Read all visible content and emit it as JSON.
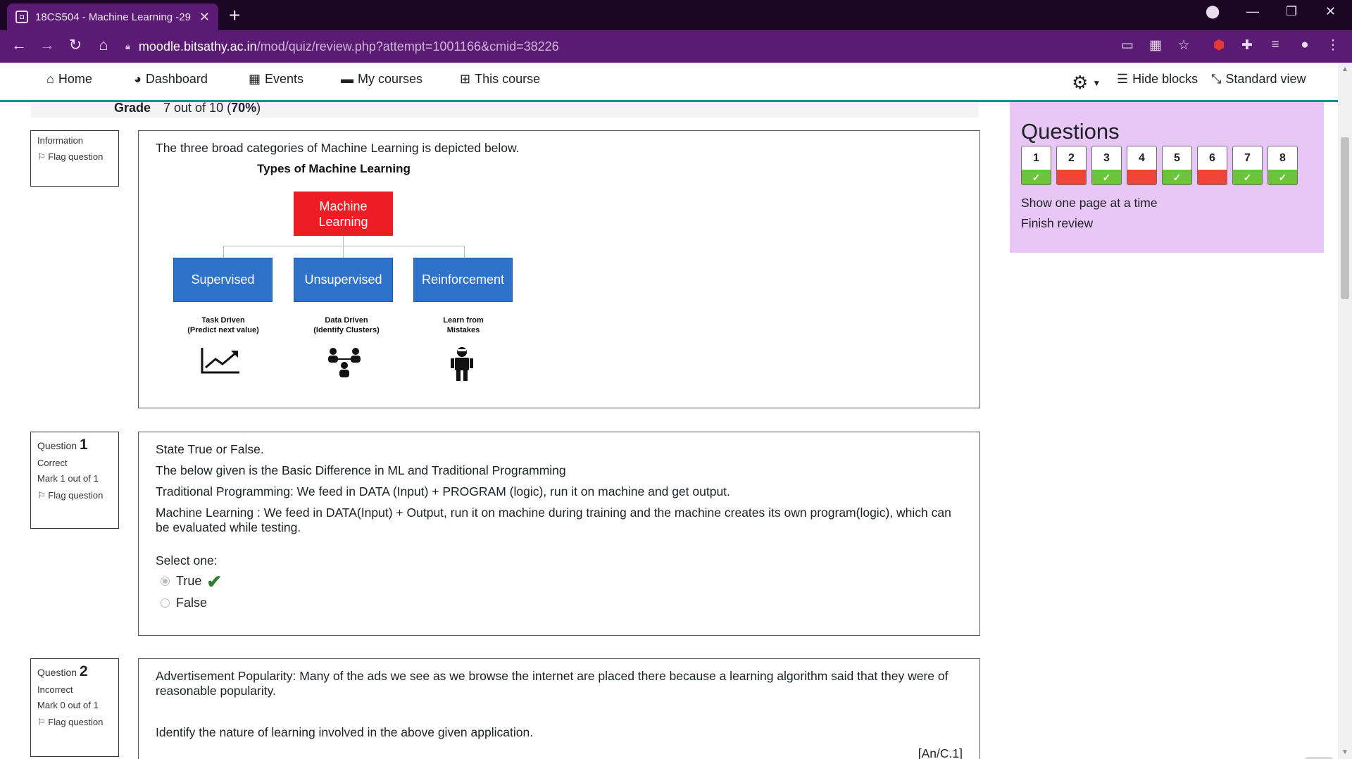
{
  "browser": {
    "tab_title": "18CS504 - Machine Learning -29",
    "tab_close": "✕",
    "new_tab": "+",
    "url_domain": "moodle.bitsathy.ac.in",
    "url_path": "/mod/quiz/review.php?attempt=1001166&cmid=38226"
  },
  "navbar": {
    "home": "Home",
    "dashboard": "Dashboard",
    "events": "Events",
    "my_courses": "My courses",
    "this_course": "This course",
    "hide_blocks": "Hide blocks",
    "standard_view": "Standard view"
  },
  "grade": {
    "label": "Grade",
    "value": "7",
    "suffix": " out of 10 (",
    "percent": "70%",
    "close": ")"
  },
  "information": {
    "label": "Information",
    "flag": "Flag question",
    "text": "The three broad categories of Machine Learning is depicted below.",
    "diagram": {
      "title": "Types of Machine Learning",
      "root": "Machine Learning",
      "children": [
        {
          "label": "Supervised",
          "caption_1": "Task Driven",
          "caption_2": "(Predict next value)",
          "icon": "trend-chart-icon"
        },
        {
          "label": "Unsupervised",
          "caption_1": "Data Driven",
          "caption_2": "(Identify Clusters)",
          "icon": "cluster-people-icon"
        },
        {
          "label": "Reinforcement",
          "caption_1": "Learn from",
          "caption_2": "Mistakes",
          "icon": "robot-icon"
        }
      ]
    }
  },
  "question1": {
    "label": "Question",
    "number": "1",
    "state": "Correct",
    "mark": "Mark 1 out of 1",
    "flag": "Flag question",
    "lines": [
      "State True or False.",
      "The below given is the Basic Difference in ML and Traditional Programming",
      "Traditional Programming: We feed in DATA (Input) + PROGRAM (logic), run it on machine and get output.",
      "Machine Learning : We feed in DATA(Input) + Output, run it on machine during training and the machine creates its own program(logic), which can be evaluated while testing."
    ],
    "prompt": "Select one:",
    "options": [
      "True",
      "False"
    ],
    "selected": "True"
  },
  "question2": {
    "label": "Question",
    "number": "2",
    "state": "Incorrect",
    "mark": "Mark 0 out of 1",
    "flag": "Flag question",
    "text": "Advertisement Popularity: Many of the ads we see as we browse the internet are placed there because a learning algorithm said that they were of reasonable popularity.",
    "instruction": "Identify the nature of learning involved in the above given application.",
    "tag": "[An/C.1]"
  },
  "questions_block": {
    "title": "Questions",
    "items": [
      {
        "num": "1",
        "status": "correct"
      },
      {
        "num": "2",
        "status": "incorrect"
      },
      {
        "num": "3",
        "status": "correct"
      },
      {
        "num": "4",
        "status": "incorrect"
      },
      {
        "num": "5",
        "status": "correct"
      },
      {
        "num": "6",
        "status": "incorrect"
      },
      {
        "num": "7",
        "status": "correct"
      },
      {
        "num": "8",
        "status": "correct"
      }
    ],
    "show_one_page": "Show one page at a time",
    "finish_review": "Finish review"
  },
  "colors": {
    "correct": "#6ec33d",
    "incorrect": "#f0433a",
    "block_bg": "#e8c6f6",
    "chrome": "#5b1a73",
    "nav_accent": "#0f8e93"
  }
}
